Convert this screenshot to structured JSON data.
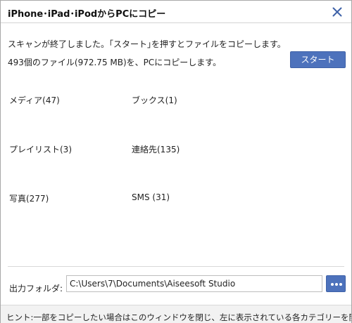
{
  "window": {
    "title": "iPhone･iPad･iPodからPCにコピー"
  },
  "messages": {
    "scan_done": "スキャンが終了しました。｢スタート｣を押すとファイルをコピーします。",
    "summary": "493個のファイル(972.75 MB)を、PCにコピーします。"
  },
  "buttons": {
    "start_label": "スタート"
  },
  "categories": [
    {
      "label": "メディア(47)"
    },
    {
      "label": "ブックス(1)"
    },
    {
      "label": "プレイリスト(3)"
    },
    {
      "label": "連絡先(135)"
    },
    {
      "label": "写真(277)"
    },
    {
      "label": "SMS (31)"
    }
  ],
  "output": {
    "label": "出力フォルダ:",
    "path": "C:\\Users\\7\\Documents\\Aiseesoft Studio"
  },
  "hint": "ヒント:一部をコピーしたい場合はこのウィンドウを閉じ、左に表示されている各カテゴリーを開い",
  "colors": {
    "accent": "#4d72bc",
    "hint_bg": "#f2f2f2"
  },
  "icons": {
    "close": "close-icon",
    "browse": "more-horizontal-icon"
  }
}
